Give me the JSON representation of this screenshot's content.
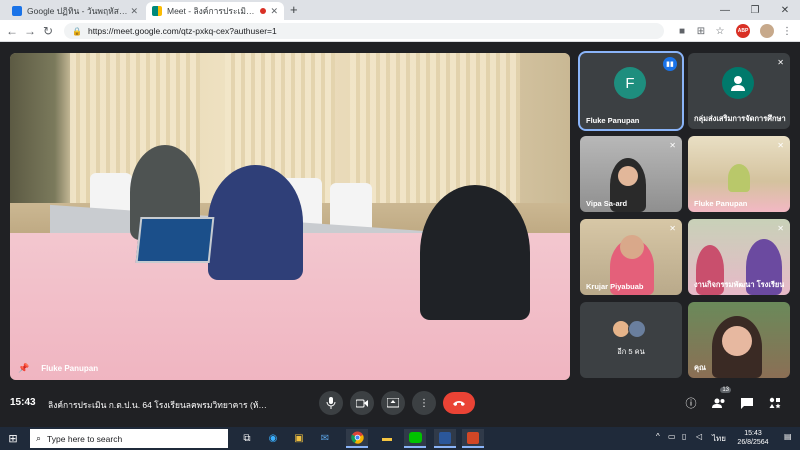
{
  "browser": {
    "tabs": [
      {
        "title": "Google ปฏิทิน - วันพฤหัสบดี, 26 สิงหาคม",
        "favicon_color": "#1a73e8",
        "active": false
      },
      {
        "title": "Meet - ลิงค์การประเมิน ก.ต.ป.น.",
        "favicon_color": "#00897b",
        "active": true
      }
    ],
    "new_tab": "+",
    "url": "https://meet.google.com/qtz-pxkq-cex?authuser=1",
    "extension_label": "ABP"
  },
  "meet": {
    "main_video": {
      "name": "Fluke Panupan"
    },
    "tiles": [
      {
        "name": "Fluke Panupan",
        "avatar_letter": "F",
        "avatar_color": "#1e8e7e",
        "speaking": true
      },
      {
        "name": "กลุ่มส่งเสริมการจัดการศึกษา",
        "avatar_letter": "",
        "avatar_color": "#00796b",
        "speaking": false
      },
      {
        "name": "Vipa Sa-ard",
        "speaking": false
      },
      {
        "name": "Fluke Panupan",
        "speaking": false
      },
      {
        "name": "Krujar Piyabuab",
        "speaking": false
      },
      {
        "name": "งานกิจกรรมพัฒนา โรงเรียน",
        "speaking": false
      },
      {
        "name": "คุณ",
        "speaking": false
      }
    ],
    "more_participants": "อีก 5 คน",
    "bottom": {
      "time": "15:43",
      "meeting_name": "ลิงค์การประเมิน ก.ต.ป.น. 64 โรงเรียนลคพรมวิทยาคาร (ห้อ...",
      "participants_count": "13"
    }
  },
  "taskbar": {
    "search_placeholder": "Type here to search",
    "language": "ไทย",
    "clock_time": "15:43",
    "clock_date": "26/8/2564"
  }
}
